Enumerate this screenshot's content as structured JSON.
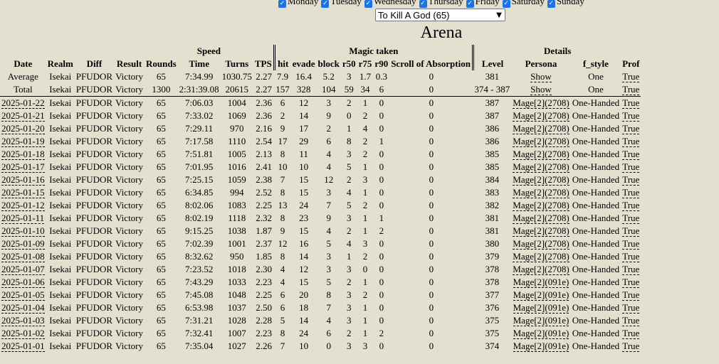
{
  "days": [
    {
      "label": "Monday"
    },
    {
      "label": "Tuesday"
    },
    {
      "label": "Wednesday"
    },
    {
      "label": "Thursday"
    },
    {
      "label": "Friday"
    },
    {
      "label": "Saturday"
    },
    {
      "label": "Sunday"
    }
  ],
  "arena_select": {
    "value": "To Kill A God (65)"
  },
  "title": "Arena",
  "groups": {
    "speed": "Speed",
    "magic": "Magic taken",
    "details": "Details"
  },
  "headers": [
    "Date",
    "Realm",
    "Diff",
    "Result",
    "Rounds",
    "Time",
    "Turns",
    "TPS",
    "hit",
    "evade",
    "block",
    "r50",
    "r75",
    "r90",
    "Scroll of Absorption",
    "Level",
    "Persona",
    "f_style",
    "Prof"
  ],
  "summary": [
    {
      "label": "Average",
      "realm": "Isekai",
      "diff": "PFUDOR",
      "result": "Victory",
      "rounds": "65",
      "time": "7:34.99",
      "turns": "1030.75",
      "tps": "2.27",
      "hit": "7.9",
      "evade": "16.4",
      "block": "5.2",
      "r50": "3",
      "r75": "1.7",
      "r90": "0.3",
      "scroll": "0",
      "level": "381",
      "persona": "Show",
      "fstyle": "One",
      "prof": "True"
    },
    {
      "label": "Total",
      "realm": "Isekai",
      "diff": "PFUDOR",
      "result": "Victory",
      "rounds": "1300",
      "time": "2:31:39.08",
      "turns": "20615",
      "tps": "2.27",
      "hit": "157",
      "evade": "328",
      "block": "104",
      "r50": "59",
      "r75": "34",
      "r90": "6",
      "scroll": "0",
      "level": "374 - 387",
      "persona": "Show",
      "fstyle": "One",
      "prof": "True"
    }
  ],
  "rows": [
    {
      "date": "2025-01-22",
      "realm": "Isekai",
      "diff": "PFUDOR",
      "result": "Victory",
      "rounds": "65",
      "time": "7:06.03",
      "turns": "1004",
      "tps": "2.36",
      "hit": "6",
      "evade": "12",
      "block": "3",
      "r50": "2",
      "r75": "1",
      "r90": "0",
      "scroll": "0",
      "level": "387",
      "persona": "Mage[2](2708)",
      "fstyle": "One-Handed",
      "prof": "True"
    },
    {
      "date": "2025-01-21",
      "realm": "Isekai",
      "diff": "PFUDOR",
      "result": "Victory",
      "rounds": "65",
      "time": "7:33.02",
      "turns": "1069",
      "tps": "2.36",
      "hit": "2",
      "evade": "14",
      "block": "9",
      "r50": "0",
      "r75": "2",
      "r90": "0",
      "scroll": "0",
      "level": "387",
      "persona": "Mage[2](2708)",
      "fstyle": "One-Handed",
      "prof": "True"
    },
    {
      "date": "2025-01-20",
      "realm": "Isekai",
      "diff": "PFUDOR",
      "result": "Victory",
      "rounds": "65",
      "time": "7:29.11",
      "turns": "970",
      "tps": "2.16",
      "hit": "9",
      "evade": "17",
      "block": "2",
      "r50": "1",
      "r75": "4",
      "r90": "0",
      "scroll": "0",
      "level": "386",
      "persona": "Mage[2](2708)",
      "fstyle": "One-Handed",
      "prof": "True"
    },
    {
      "date": "2025-01-19",
      "realm": "Isekai",
      "diff": "PFUDOR",
      "result": "Victory",
      "rounds": "65",
      "time": "7:17.58",
      "turns": "1110",
      "tps": "2.54",
      "hit": "17",
      "evade": "29",
      "block": "6",
      "r50": "8",
      "r75": "2",
      "r90": "1",
      "scroll": "0",
      "level": "386",
      "persona": "Mage[2](2708)",
      "fstyle": "One-Handed",
      "prof": "True"
    },
    {
      "date": "2025-01-18",
      "realm": "Isekai",
      "diff": "PFUDOR",
      "result": "Victory",
      "rounds": "65",
      "time": "7:51.81",
      "turns": "1005",
      "tps": "2.13",
      "hit": "8",
      "evade": "11",
      "block": "4",
      "r50": "3",
      "r75": "2",
      "r90": "0",
      "scroll": "0",
      "level": "385",
      "persona": "Mage[2](2708)",
      "fstyle": "One-Handed",
      "prof": "True"
    },
    {
      "date": "2025-01-17",
      "realm": "Isekai",
      "diff": "PFUDOR",
      "result": "Victory",
      "rounds": "65",
      "time": "7:01.95",
      "turns": "1016",
      "tps": "2.41",
      "hit": "10",
      "evade": "10",
      "block": "4",
      "r50": "5",
      "r75": "1",
      "r90": "0",
      "scroll": "0",
      "level": "385",
      "persona": "Mage[2](2708)",
      "fstyle": "One-Handed",
      "prof": "True"
    },
    {
      "date": "2025-01-16",
      "realm": "Isekai",
      "diff": "PFUDOR",
      "result": "Victory",
      "rounds": "65",
      "time": "7:25.15",
      "turns": "1059",
      "tps": "2.38",
      "hit": "7",
      "evade": "15",
      "block": "12",
      "r50": "2",
      "r75": "3",
      "r90": "0",
      "scroll": "0",
      "level": "384",
      "persona": "Mage[2](2708)",
      "fstyle": "One-Handed",
      "prof": "True"
    },
    {
      "date": "2025-01-15",
      "realm": "Isekai",
      "diff": "PFUDOR",
      "result": "Victory",
      "rounds": "65",
      "time": "6:34.85",
      "turns": "994",
      "tps": "2.52",
      "hit": "8",
      "evade": "15",
      "block": "3",
      "r50": "4",
      "r75": "1",
      "r90": "0",
      "scroll": "0",
      "level": "383",
      "persona": "Mage[2](2708)",
      "fstyle": "One-Handed",
      "prof": "True"
    },
    {
      "date": "2025-01-12",
      "realm": "Isekai",
      "diff": "PFUDOR",
      "result": "Victory",
      "rounds": "65",
      "time": "8:02.06",
      "turns": "1083",
      "tps": "2.25",
      "hit": "13",
      "evade": "24",
      "block": "7",
      "r50": "5",
      "r75": "2",
      "r90": "0",
      "scroll": "0",
      "level": "382",
      "persona": "Mage[2](2708)",
      "fstyle": "One-Handed",
      "prof": "True"
    },
    {
      "date": "2025-01-11",
      "realm": "Isekai",
      "diff": "PFUDOR",
      "result": "Victory",
      "rounds": "65",
      "time": "8:02.19",
      "turns": "1118",
      "tps": "2.32",
      "hit": "8",
      "evade": "23",
      "block": "9",
      "r50": "3",
      "r75": "1",
      "r90": "1",
      "scroll": "0",
      "level": "381",
      "persona": "Mage[2](2708)",
      "fstyle": "One-Handed",
      "prof": "True"
    },
    {
      "date": "2025-01-10",
      "realm": "Isekai",
      "diff": "PFUDOR",
      "result": "Victory",
      "rounds": "65",
      "time": "9:15.25",
      "turns": "1038",
      "tps": "1.87",
      "hit": "9",
      "evade": "15",
      "block": "4",
      "r50": "2",
      "r75": "1",
      "r90": "2",
      "scroll": "0",
      "level": "381",
      "persona": "Mage[2](2708)",
      "fstyle": "One-Handed",
      "prof": "True"
    },
    {
      "date": "2025-01-09",
      "realm": "Isekai",
      "diff": "PFUDOR",
      "result": "Victory",
      "rounds": "65",
      "time": "7:02.39",
      "turns": "1001",
      "tps": "2.37",
      "hit": "12",
      "evade": "16",
      "block": "5",
      "r50": "4",
      "r75": "3",
      "r90": "0",
      "scroll": "0",
      "level": "380",
      "persona": "Mage[2](2708)",
      "fstyle": "One-Handed",
      "prof": "True"
    },
    {
      "date": "2025-01-08",
      "realm": "Isekai",
      "diff": "PFUDOR",
      "result": "Victory",
      "rounds": "65",
      "time": "8:32.62",
      "turns": "950",
      "tps": "1.85",
      "hit": "8",
      "evade": "14",
      "block": "3",
      "r50": "1",
      "r75": "2",
      "r90": "0",
      "scroll": "0",
      "level": "379",
      "persona": "Mage[2](2708)",
      "fstyle": "One-Handed",
      "prof": "True"
    },
    {
      "date": "2025-01-07",
      "realm": "Isekai",
      "diff": "PFUDOR",
      "result": "Victory",
      "rounds": "65",
      "time": "7:23.52",
      "turns": "1018",
      "tps": "2.30",
      "hit": "4",
      "evade": "12",
      "block": "3",
      "r50": "3",
      "r75": "0",
      "r90": "0",
      "scroll": "0",
      "level": "378",
      "persona": "Mage[2](2708)",
      "fstyle": "One-Handed",
      "prof": "True"
    },
    {
      "date": "2025-01-06",
      "realm": "Isekai",
      "diff": "PFUDOR",
      "result": "Victory",
      "rounds": "65",
      "time": "7:43.29",
      "turns": "1033",
      "tps": "2.23",
      "hit": "4",
      "evade": "15",
      "block": "5",
      "r50": "2",
      "r75": "1",
      "r90": "0",
      "scroll": "0",
      "level": "378",
      "persona": "Mage[2](091e)",
      "fstyle": "One-Handed",
      "prof": "True"
    },
    {
      "date": "2025-01-05",
      "realm": "Isekai",
      "diff": "PFUDOR",
      "result": "Victory",
      "rounds": "65",
      "time": "7:45.08",
      "turns": "1048",
      "tps": "2.25",
      "hit": "6",
      "evade": "20",
      "block": "8",
      "r50": "3",
      "r75": "2",
      "r90": "0",
      "scroll": "0",
      "level": "377",
      "persona": "Mage[2](091e)",
      "fstyle": "One-Handed",
      "prof": "True"
    },
    {
      "date": "2025-01-04",
      "realm": "Isekai",
      "diff": "PFUDOR",
      "result": "Victory",
      "rounds": "65",
      "time": "6:53.98",
      "turns": "1037",
      "tps": "2.50",
      "hit": "6",
      "evade": "18",
      "block": "7",
      "r50": "3",
      "r75": "1",
      "r90": "0",
      "scroll": "0",
      "level": "376",
      "persona": "Mage[2](091e)",
      "fstyle": "One-Handed",
      "prof": "True"
    },
    {
      "date": "2025-01-03",
      "realm": "Isekai",
      "diff": "PFUDOR",
      "result": "Victory",
      "rounds": "65",
      "time": "7:31.21",
      "turns": "1028",
      "tps": "2.28",
      "hit": "5",
      "evade": "14",
      "block": "4",
      "r50": "3",
      "r75": "1",
      "r90": "0",
      "scroll": "0",
      "level": "375",
      "persona": "Mage[2](091e)",
      "fstyle": "One-Handed",
      "prof": "True"
    },
    {
      "date": "2025-01-02",
      "realm": "Isekai",
      "diff": "PFUDOR",
      "result": "Victory",
      "rounds": "65",
      "time": "7:32.41",
      "turns": "1007",
      "tps": "2.23",
      "hit": "8",
      "evade": "24",
      "block": "6",
      "r50": "2",
      "r75": "1",
      "r90": "2",
      "scroll": "0",
      "level": "375",
      "persona": "Mage[2](091e)",
      "fstyle": "One-Handed",
      "prof": "True"
    },
    {
      "date": "2025-01-01",
      "realm": "Isekai",
      "diff": "PFUDOR",
      "result": "Victory",
      "rounds": "65",
      "time": "7:35.04",
      "turns": "1027",
      "tps": "2.26",
      "hit": "7",
      "evade": "10",
      "block": "0",
      "r50": "3",
      "r75": "3",
      "r90": "0",
      "scroll": "0",
      "level": "374",
      "persona": "Mage[2](091e)",
      "fstyle": "One-Handed",
      "prof": "True"
    }
  ]
}
